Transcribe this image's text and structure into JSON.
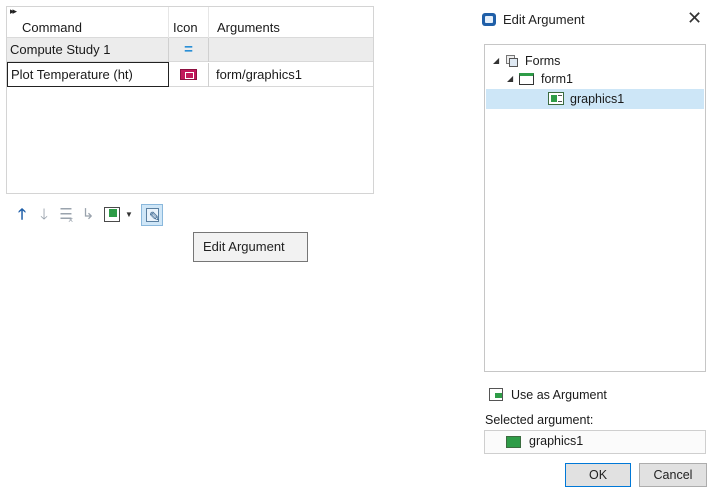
{
  "table": {
    "headers": {
      "command": "Command",
      "icon": "Icon",
      "arguments": "Arguments"
    },
    "expand_glyph": "▸▸",
    "rows": [
      {
        "command": "Compute Study 1",
        "icon": "equals-icon",
        "icon_glyph": "=",
        "arguments": ""
      },
      {
        "command": "Plot Temperature (ht)",
        "icon": "plot-icon",
        "arguments": "form/graphics1"
      }
    ]
  },
  "toolbar": {
    "items": [
      "move-up-icon",
      "move-down-icon",
      "delete-icon",
      "move-to-icon",
      "insert-icon",
      "dropdown-caret-icon",
      "edit-argument-icon"
    ],
    "up_glyph": "🡑",
    "down_glyph": "🡓",
    "delete_glyph": "☰",
    "delete_x": "×",
    "move_glyph": "↳",
    "caret_glyph": "▼",
    "pencil_glyph": "✎",
    "tooltip": "Edit Argument"
  },
  "dialog": {
    "title": "Edit Argument",
    "close_glyph": "✕",
    "tree": {
      "expanded_glyph": "◢",
      "root": "Forms",
      "child": "form1",
      "leaf": "graphics1"
    },
    "use_as_argument": "Use as Argument",
    "selected_label": "Selected argument:",
    "selected_value": "graphics1",
    "ok": "OK",
    "cancel": "Cancel"
  },
  "colors": {
    "selection": "#cde6f7",
    "accent_blue": "#0078d7",
    "plot_icon": "#c2185b",
    "green": "#2e9c47"
  }
}
